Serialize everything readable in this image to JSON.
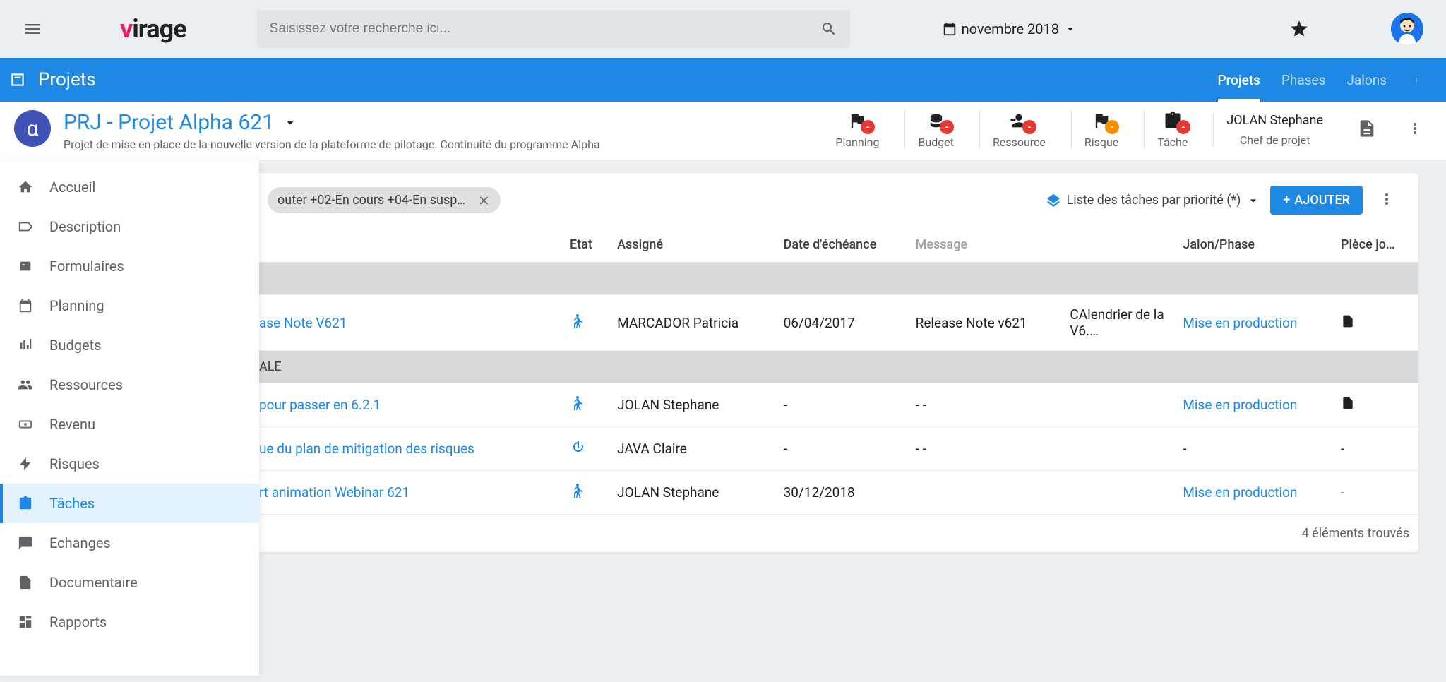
{
  "topbar": {
    "search_placeholder": "Saisissez votre recherche ici...",
    "date_label": "novembre 2018"
  },
  "logo": {
    "prefix": "v",
    "rest": "irage"
  },
  "navbar": {
    "title": "Projets",
    "tabs": [
      "Projets",
      "Phases",
      "Jalons"
    ]
  },
  "project": {
    "avatar_letter": "α",
    "title": "PRJ - Projet Alpha 621",
    "desc": "Projet de mise en place de la nouvelle version de la plateforme de pilotage. Continuité du programme Alpha",
    "kpis": [
      "Planning",
      "Budget",
      "Ressource",
      "Risque",
      "Tâche"
    ],
    "manager_name": "JOLAN Stephane",
    "manager_label": "Chef de projet"
  },
  "sidebar": {
    "items": [
      "Accueil",
      "Description",
      "Formulaires",
      "Planning",
      "Budgets",
      "Ressources",
      "Revenu",
      "Risques",
      "Tâches",
      "Echanges",
      "Documentaire",
      "Rapports"
    ]
  },
  "filter": {
    "chip": "outer +02-En cours +04-En suspens…",
    "view_label": "Liste des tâches par priorité (*)",
    "add_label": "AJOUTER"
  },
  "columns": {
    "state": "Etat",
    "assignee": "Assigné",
    "due": "Date d'échéance",
    "message": "Message",
    "phase": "Jalon/Phase",
    "attach": "Pièce jo…"
  },
  "groups": {
    "g1": "ALE"
  },
  "rows": {
    "r1": {
      "title": "ase Note V621",
      "assignee": "MARCADOR Patricia",
      "due": "06/04/2017",
      "msg": "Release Note v621",
      "msg2": "CAlendrier de la V6.…",
      "phase": "Mise en production"
    },
    "r2": {
      "title": "pour passer en 6.2.1",
      "assignee": "JOLAN Stephane",
      "due": "-",
      "msg": "- -",
      "phase": "Mise en production"
    },
    "r3": {
      "title": "ue du plan de mitigation des risques",
      "assignee": "JAVA Claire",
      "due": "-",
      "msg": "- -",
      "phase": "-"
    },
    "r4": {
      "title": "rt animation Webinar 621",
      "assignee": "JOLAN Stephane",
      "due": "30/12/2018",
      "msg": "",
      "phase": "Mise en production",
      "attach": "-"
    }
  },
  "footer": "4 éléments trouvés"
}
